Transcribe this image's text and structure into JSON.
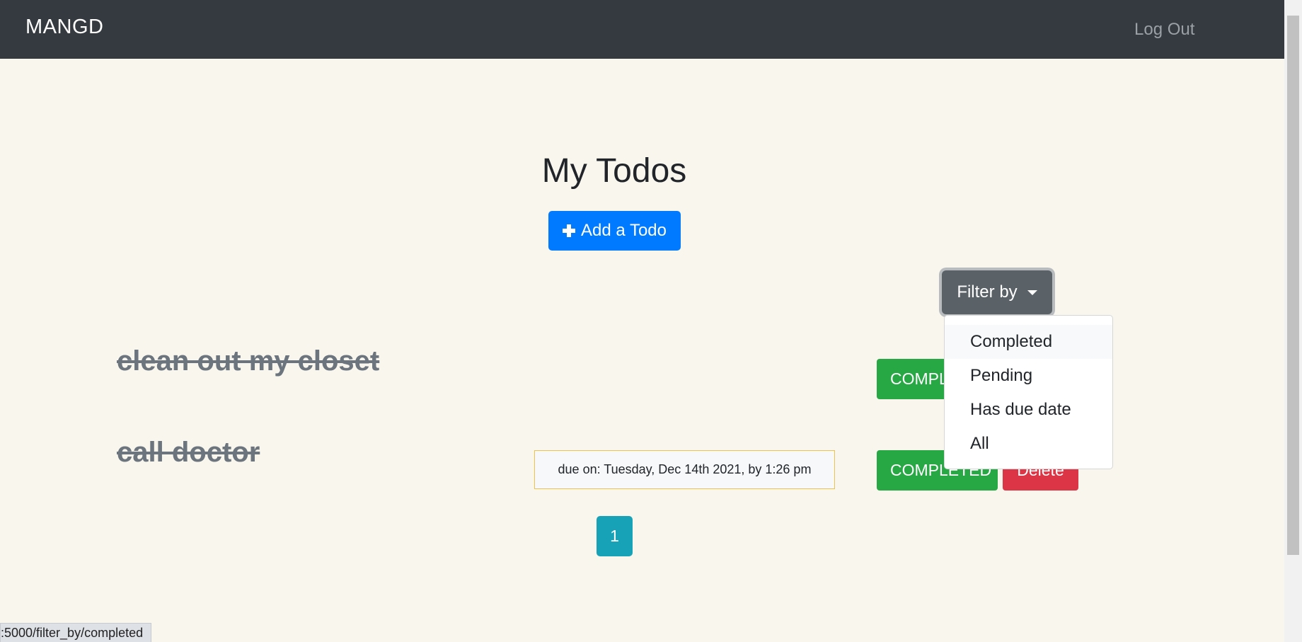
{
  "navbar": {
    "brand": "MANGD",
    "logout_label": "Log Out"
  },
  "main": {
    "title": "My Todos",
    "add_button_label": "Add a Todo"
  },
  "filter": {
    "button_label": "Filter by",
    "options": [
      "Completed",
      "Pending",
      "Has due date",
      "All"
    ],
    "hovered_option": "Completed"
  },
  "todos": [
    {
      "text": "clean out my closet",
      "status_label": "COMPLETED",
      "due": ""
    },
    {
      "text": "call doctor",
      "status_label": "COMPLETED",
      "due": "due on: Tuesday, Dec 14th 2021, by 1:26 pm",
      "delete_label": "Delete"
    }
  ],
  "pagination": {
    "current_page": "1"
  },
  "status_bar": {
    "url": ":5000/filter_by/completed"
  },
  "colors": {
    "navbar": "#343a40",
    "background": "#f9f6ee",
    "primary": "#007bff",
    "success": "#28a745",
    "danger": "#dc3545",
    "info": "#17a2b8",
    "secondary": "#5a6268"
  }
}
